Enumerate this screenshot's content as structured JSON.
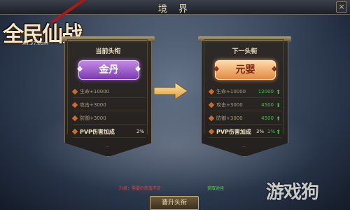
{
  "window": {
    "title": "境 界",
    "close_label": "×"
  },
  "logo": {
    "brand": "全民仙战",
    "url": "xn.37.com"
  },
  "current": {
    "heading": "当前头衔",
    "title_plate": "金丹",
    "stats": [
      {
        "label": "生命+10000",
        "value": "",
        "up": false
      },
      {
        "label": "攻击+3000",
        "value": "",
        "up": false
      },
      {
        "label": "防御+3000",
        "value": "",
        "up": false
      }
    ],
    "pvp": {
      "label": "PVP伤害加成",
      "value": "2%"
    }
  },
  "next": {
    "heading": "下一头衔",
    "title_plate": "元婴",
    "stats": [
      {
        "label": "生命+10000",
        "value": "12000",
        "up": true
      },
      {
        "label": "攻击+3000",
        "value": "4500",
        "up": true
      },
      {
        "label": "防御+3000",
        "value": "4500",
        "up": true
      }
    ],
    "pvp": {
      "label": "PVP伤害加成",
      "value": "3%",
      "extra": "1%"
    }
  },
  "footer": {
    "message": "升级：需要历练值不足",
    "link": "获取途径"
  },
  "button": {
    "label": "晋升头衔"
  },
  "watermark": "游戏狗",
  "colors": {
    "accent_green": "#43c24a",
    "plate_purple": "#7a3ab0",
    "plate_orange": "#e08a40"
  }
}
